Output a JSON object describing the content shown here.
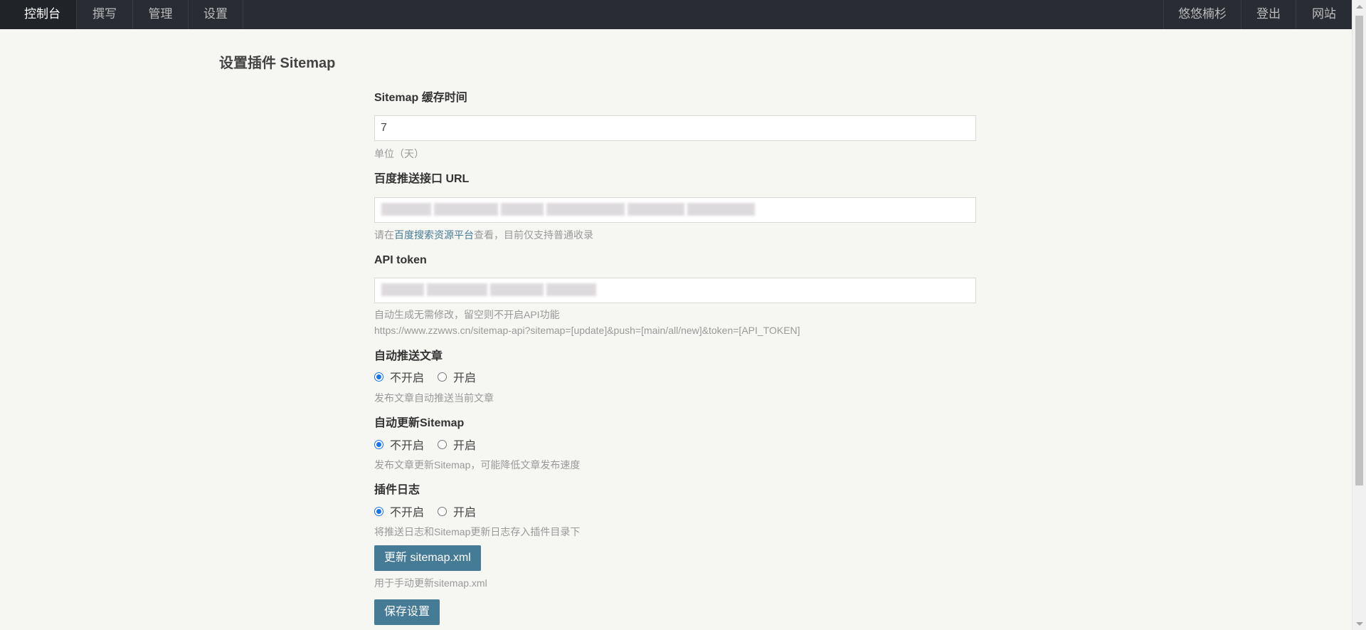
{
  "nav": {
    "left": [
      {
        "label": "控制台",
        "active": true
      },
      {
        "label": "撰写",
        "active": false
      },
      {
        "label": "管理",
        "active": false
      },
      {
        "label": "设置",
        "active": false
      }
    ],
    "right": [
      {
        "label": "悠悠楠杉"
      },
      {
        "label": "登出"
      },
      {
        "label": "网站"
      }
    ]
  },
  "page_title": "设置插件 Sitemap",
  "fields": {
    "cache_time": {
      "label": "Sitemap 缓存时间",
      "value": "7",
      "desc": "单位（天）"
    },
    "baidu_url": {
      "label": "百度推送接口 URL",
      "value": "",
      "desc_prefix": "请在",
      "desc_link": "百度搜索资源平台",
      "desc_suffix": "查看，目前仅支持普通收录"
    },
    "api_token": {
      "label": "API token",
      "value": "",
      "desc_line1": "自动生成无需修改，留空则不开启API功能",
      "desc_line2": "https://www.zzwws.cn/sitemap-api?sitemap=[update]&push=[main/all/new]&token=[API_TOKEN]"
    },
    "auto_push": {
      "label": "自动推送文章",
      "options": [
        "不开启",
        "开启"
      ],
      "selected": "不开启",
      "desc": "发布文章自动推送当前文章"
    },
    "auto_update": {
      "label": "自动更新Sitemap",
      "options": [
        "不开启",
        "开启"
      ],
      "selected": "不开启",
      "desc": "发布文章更新Sitemap，可能降低文章发布速度"
    },
    "plugin_log": {
      "label": "插件日志",
      "options": [
        "不开启",
        "开启"
      ],
      "selected": "不开启",
      "desc": "将推送日志和Sitemap更新日志存入插件目录下"
    }
  },
  "update_button": {
    "label": "更新 sitemap.xml",
    "desc": "用于手动更新sitemap.xml"
  },
  "save_button": {
    "label": "保存设置"
  },
  "colors": {
    "nav_bg": "#292d33",
    "page_bg": "#f6f6f3",
    "button": "#467b96",
    "link": "#467b96",
    "radio": "#1a73e8"
  }
}
